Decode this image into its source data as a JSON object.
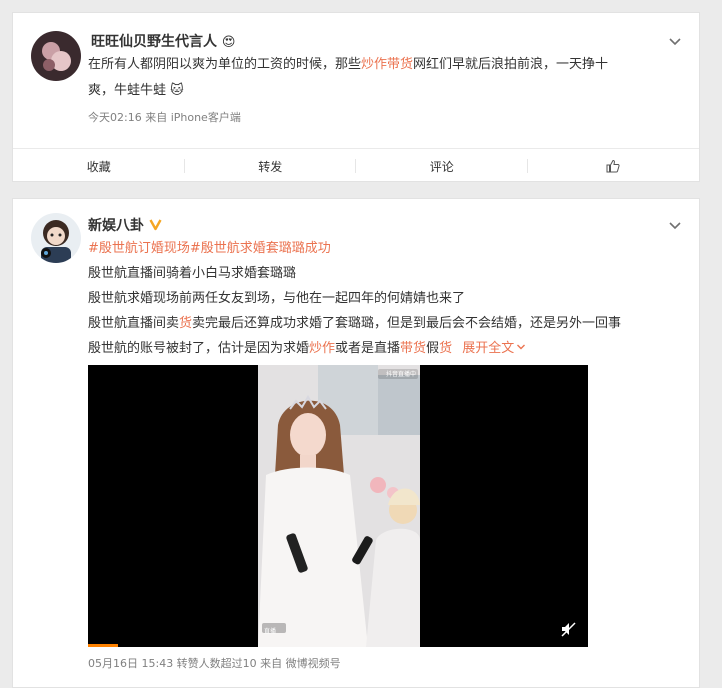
{
  "post1": {
    "username": "旺旺仙贝野生代言人",
    "badge_emoji": "😍",
    "text_line1_before": "在所有人都阴阳以爽为单位的工资的时候，那些",
    "text_line1_keyword": "炒作带货",
    "text_line1_after": "网红们早就后浪拍前浪，一天挣十",
    "text_line2": "爽，牛蛙牛蛙",
    "text_line2_emoji": "🐱",
    "meta": "今天02:16  来自 iPhone客户端",
    "actions": {
      "favorite": "收藏",
      "repost": "转发",
      "comment": "评论"
    }
  },
  "post2": {
    "username": "新娱八卦",
    "verified_icon": "verified-v-icon",
    "topic1": "#殷世航订婚现场#",
    "topic2": "殷世航求婚套璐璐成功",
    "line1": "殷世航直播间骑着小白马求婚套璐璐",
    "line2": "殷世航求婚现场前两任女友到场，与他在一起四年的何婧婧也来了",
    "line3_a": "殷世航直播间卖",
    "line3_kw": "货",
    "line3_b": "卖完最后还算成功求婚了套璐璐，但是到最后会不会结婚，还是另外一回事",
    "line4_a": "殷世航的账号被封了，估计是因为求婚",
    "line4_kw1": "炒作",
    "line4_b": "或者是直播",
    "line4_kw2": "带货",
    "line4_c": "假",
    "line4_kw3": "货",
    "expand": "展开全文",
    "video_watermark": "抖音直播中",
    "video_tag": "直播",
    "meta": "05月16日 15:43 转赞人数超过10 来自 微博视频号"
  },
  "colors": {
    "accent": "#eb7350",
    "link": "#eb7350",
    "verified": "#f5a623",
    "progress": "#ff8200"
  }
}
